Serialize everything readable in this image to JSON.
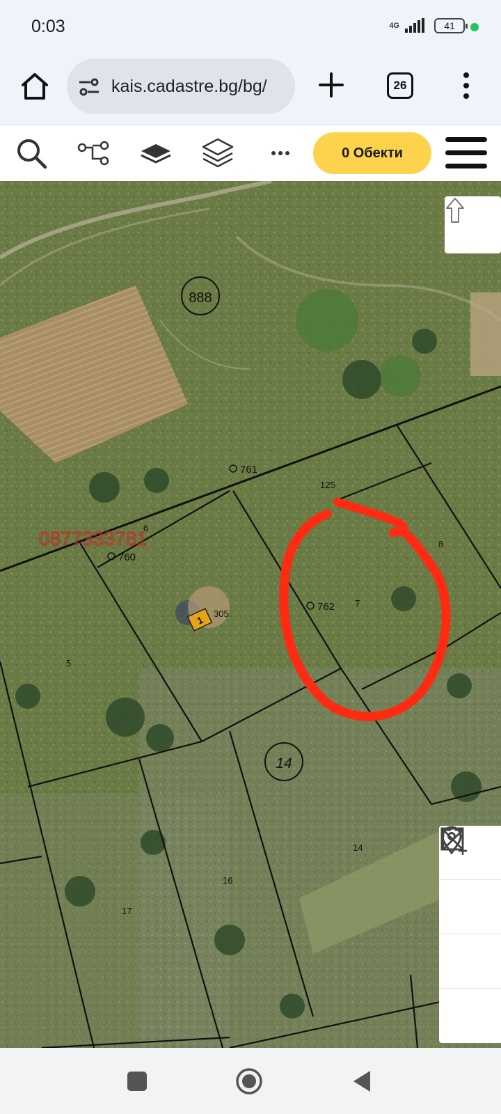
{
  "status_bar": {
    "time": "0:03",
    "network": "4G",
    "battery": "41",
    "privacy_dot_color": "#22c55e"
  },
  "browser": {
    "url": "kais.cadastre.bg/bg/",
    "tab_count": "26",
    "icons": [
      "home-icon",
      "site-info-icon",
      "new-tab-icon",
      "tab-switcher-icon",
      "more-vert-icon"
    ]
  },
  "toolbar": {
    "objects_label": "0 Обекти",
    "objects_color": "#fdd34d",
    "icons": [
      "search-icon",
      "route-icon",
      "layer-icon",
      "layers-icon",
      "more-horiz-icon",
      "hamburger-menu-icon"
    ]
  },
  "map": {
    "region_numbers": [
      "888",
      "14"
    ],
    "parcel_ids": [
      "761",
      "760",
      "762"
    ],
    "parcel_numbers": [
      "125",
      "6",
      "8",
      "7",
      "5",
      "16",
      "17",
      "14"
    ],
    "building_label": "1",
    "building_number": "305",
    "watermark": "0877333781",
    "highlight_color": "#ff2a12",
    "controls": [
      "arrow-up-icon",
      "location-pin-icon",
      "add-area-icon",
      "remove-area-icon",
      "fullscreen-icon"
    ]
  },
  "navigation": {
    "icons": [
      "recent-apps-icon",
      "home-circle-icon",
      "back-triangle-icon"
    ]
  }
}
